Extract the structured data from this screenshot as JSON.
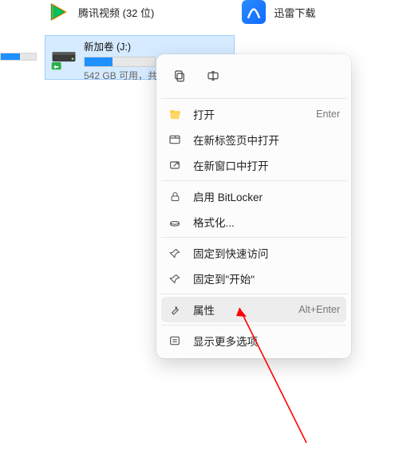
{
  "desktop": {
    "tencent_label": "腾讯视频 (32 位)",
    "xunlei_label": "迅雷下载"
  },
  "drive": {
    "name": "新加卷 (J:)",
    "sub": "542 GB 可用，共"
  },
  "ctx": {
    "open": "打开",
    "open_shortcut": "Enter",
    "open_tab": "在新标签页中打开",
    "open_win": "在新窗口中打开",
    "bitlocker": "启用 BitLocker",
    "format": "格式化...",
    "pin_quick": "固定到快速访问",
    "pin_start": "固定到\"开始\"",
    "properties": "属性",
    "properties_shortcut": "Alt+Enter",
    "more": "显示更多选项"
  }
}
